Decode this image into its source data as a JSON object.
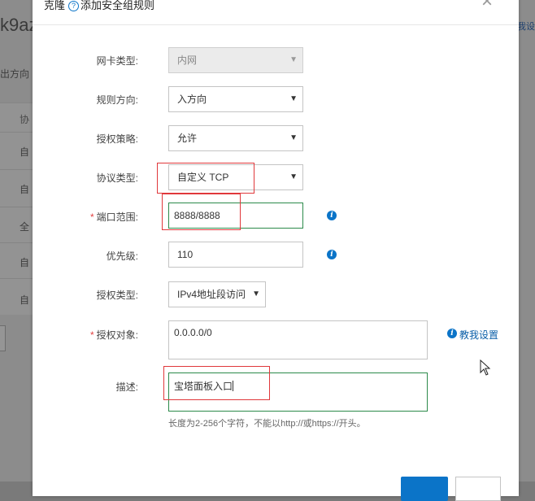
{
  "background": {
    "title_fragment": "k9az",
    "tab_fragment": "出方向",
    "header_fragment": "协",
    "link_fragment": "我设",
    "row_fragments": [
      "自",
      "自",
      "全",
      "自",
      "自"
    ]
  },
  "dialog": {
    "title_prefix": "克隆",
    "title": "添加安全组规则",
    "close_symbol": "×",
    "fields": {
      "nic_type": {
        "label": "网卡类型:",
        "value": "内网",
        "disabled": true
      },
      "direction": {
        "label": "规则方向:",
        "value": "入方向"
      },
      "policy": {
        "label": "授权策略:",
        "value": "允许"
      },
      "protocol": {
        "label": "协议类型:",
        "value": "自定义 TCP"
      },
      "port_range": {
        "label": "端口范围:",
        "value": "8888/8888",
        "required": true
      },
      "priority": {
        "label": "优先级:",
        "value": "110"
      },
      "auth_type": {
        "label": "授权类型:",
        "value": "IPv4地址段访问"
      },
      "auth_object": {
        "label": "授权对象:",
        "value": "0.0.0.0/0",
        "required": true,
        "help_link": "教我设置"
      },
      "description": {
        "label": "描述:",
        "value": "宝塔面板入口",
        "hint": "长度为2-256个字符，不能以http://或https://开头。"
      }
    }
  },
  "colors": {
    "accent": "#0b74c8",
    "highlight_red": "#e0383b",
    "focus_green": "#2c8a4a"
  },
  "icons": {
    "help": "question-circle-icon",
    "info": "info-circle-icon",
    "caret": "caret-down-icon",
    "cursor": "mouse-pointer-icon"
  }
}
